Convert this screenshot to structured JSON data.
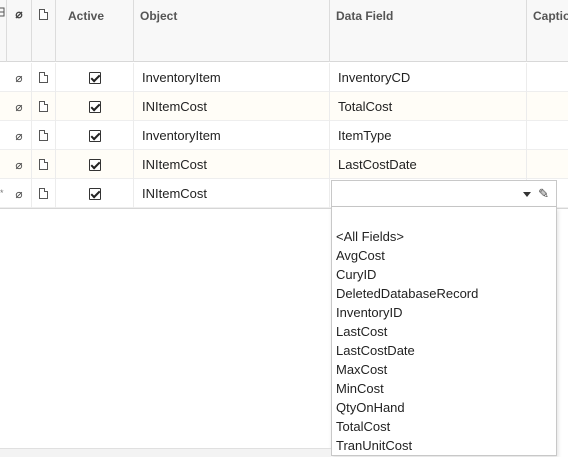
{
  "grid": {
    "headers": {
      "active": "Active",
      "object": "Object",
      "data_field": "Data Field",
      "caption": "Caption"
    },
    "rows": [
      {
        "active": true,
        "object": "InventoryItem",
        "data_field": "InventoryCD"
      },
      {
        "active": true,
        "object": "INItemCost",
        "data_field": "TotalCost"
      },
      {
        "active": true,
        "object": "InventoryItem",
        "data_field": "ItemType"
      },
      {
        "active": true,
        "object": "INItemCost",
        "data_field": "LastCostDate"
      },
      {
        "active": true,
        "object": "INItemCost",
        "data_field": ""
      }
    ],
    "new_row_marker": "*"
  },
  "icons": {
    "header_left": "grid-icon",
    "attachment": "paperclip-icon",
    "note": "note-icon",
    "dropdown": "chevron-down-icon",
    "edit": "pencil-icon"
  },
  "dropdown": {
    "options": [
      "<All Fields>",
      "AvgCost",
      "CuryID",
      "DeletedDatabaseRecord",
      "InventoryID",
      "LastCost",
      "LastCostDate",
      "MaxCost",
      "MinCost",
      "QtyOnHand",
      "TotalCost",
      "TranUnitCost"
    ]
  }
}
